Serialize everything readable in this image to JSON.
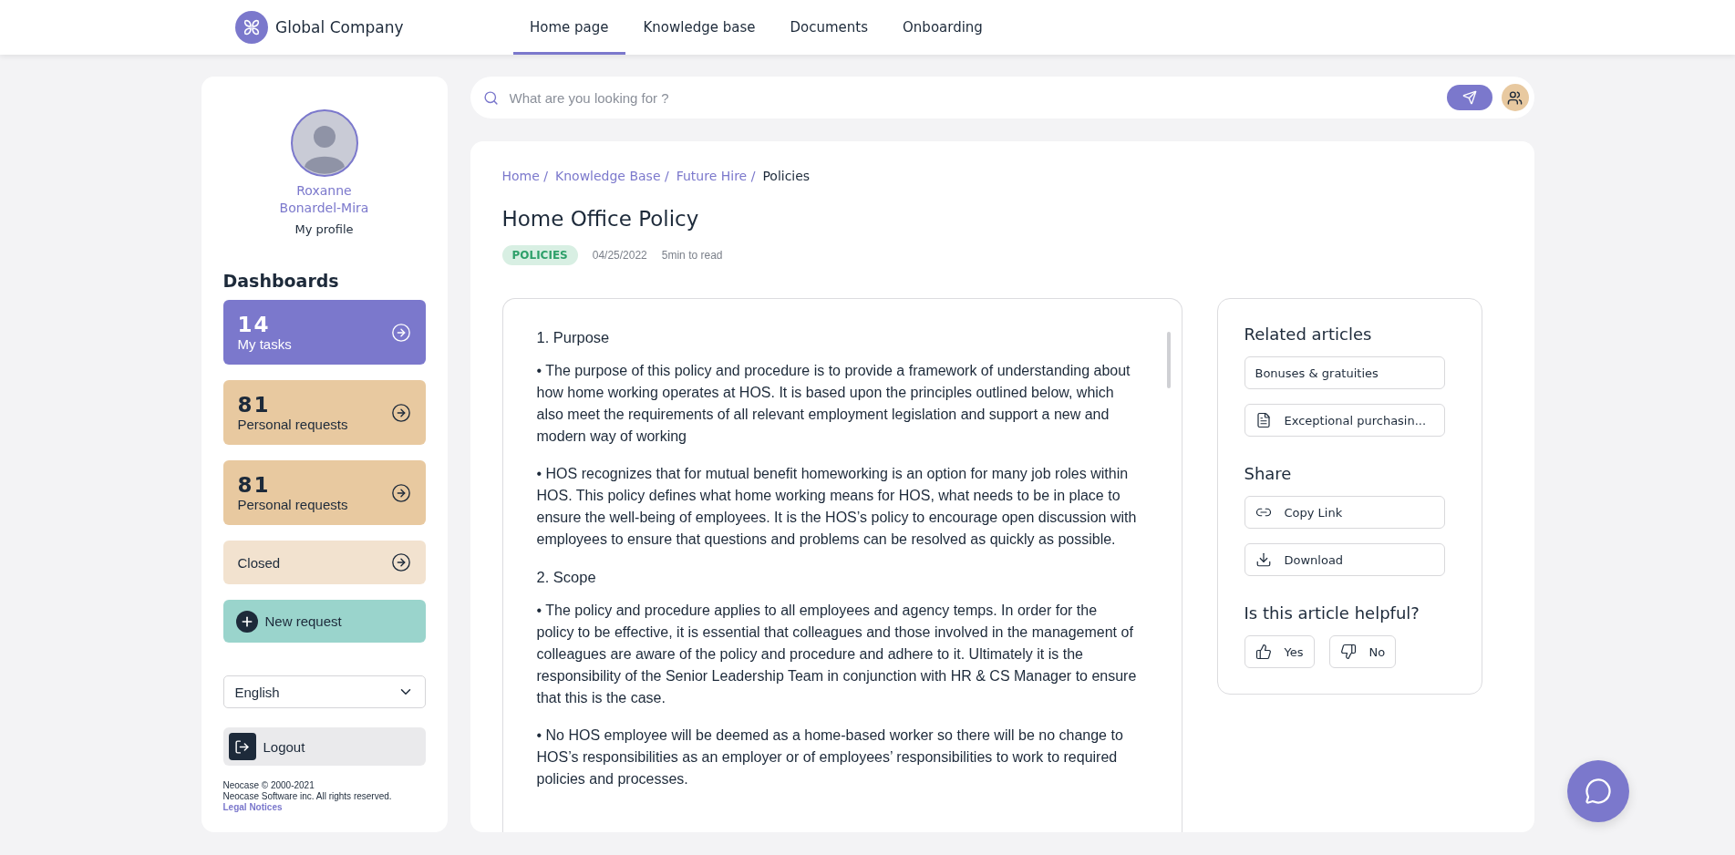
{
  "header": {
    "logo_text": "Global Company",
    "nav": [
      {
        "label": "Home page",
        "selected": true
      },
      {
        "label": "Knowledge base",
        "selected": false
      },
      {
        "label": "Documents",
        "selected": false
      },
      {
        "label": "Onboarding",
        "selected": false
      }
    ]
  },
  "sidebar": {
    "profile": {
      "first_name": "Roxanne",
      "last_name": "Bonardel-Mira",
      "link": "My profile"
    },
    "dashboards_title": "Dashboards",
    "dashboards": [
      {
        "kind": "counter",
        "count": "14",
        "label": "My tasks",
        "color": "#7b78cc"
      },
      {
        "kind": "counter",
        "count": "81",
        "label": "Personal requests",
        "color": "#e8c9a0"
      },
      {
        "kind": "counter",
        "count": "81",
        "label": "Personal requests",
        "color": "#e8c9a0"
      },
      {
        "kind": "plain",
        "label": "Closed",
        "color": "#f2e2cf"
      }
    ],
    "new_request": "New request",
    "language": "English",
    "logout": "Logout",
    "footer": {
      "copyright": "Neocase © 2000-2021",
      "rights": "Neocase Software inc. All rights reserved.",
      "legal": "Legal Notices"
    }
  },
  "search": {
    "placeholder": "What are you looking for ?"
  },
  "article": {
    "breadcrumbs": [
      {
        "label": "Home /",
        "current": false
      },
      {
        "label": "Knowledge Base /",
        "current": false
      },
      {
        "label": "Future Hire /",
        "current": false
      },
      {
        "label": "Policies",
        "current": true
      }
    ],
    "title": "Home Office Policy",
    "tag": "POLICIES",
    "date": "04/25/2022",
    "read_time": "5min to read",
    "body": [
      {
        "kind": "heading",
        "text": "1. Purpose"
      },
      {
        "kind": "paragraph",
        "text": "• The purpose of this policy and procedure is to provide a framework of understanding about how home working operates at HOS. It is based upon the principles outlined below, which also meet the requirements of all relevant employment legislation and support a new and modern way of working"
      },
      {
        "kind": "paragraph",
        "text": "• HOS  recognizes  that for mutual benefit homeworking is an option for many job roles within HOS. This policy defines what home working means for HOS, what needs to be in place to ensure the well-being of employees. It is the HOS’s policy to encourage open discussion with employees to ensure that questions and problems can be resolved as quickly as possible."
      },
      {
        "kind": "heading",
        "text": "2. Scope"
      },
      {
        "kind": "paragraph",
        "text": "• The policy and procedure applies to all employees and agency temps.  In order for  the policy to be effective, it is essential that colleagues and those involved in the management of colleagues are aware of the policy and procedure and adhere to it. Ultimately it is the responsibility of the Senior Leadership Team in conjunction with HR & CS Manager to ensure that this is the case."
      },
      {
        "kind": "paragraph",
        "text": "• No HOS employee will be deemed as a home-based worker so there will be no change to HOS’s responsibilities as an employer or of employees’ responsibilities to work to required policies and processes."
      }
    ]
  },
  "related": {
    "title": "Related articles",
    "articles": [
      {
        "kind": "plain",
        "label": "Bonuses & gratuities"
      },
      {
        "kind": "document",
        "label": "Exceptional purchasin..."
      }
    ],
    "share_title": "Share",
    "share": [
      {
        "kind": "link",
        "label": "Copy Link"
      },
      {
        "kind": "download",
        "label": "Download"
      }
    ],
    "feedback_title": "Is this article helpful?",
    "feedback": [
      {
        "kind": "up",
        "label": "Yes"
      },
      {
        "kind": "down",
        "label": "No"
      }
    ]
  }
}
